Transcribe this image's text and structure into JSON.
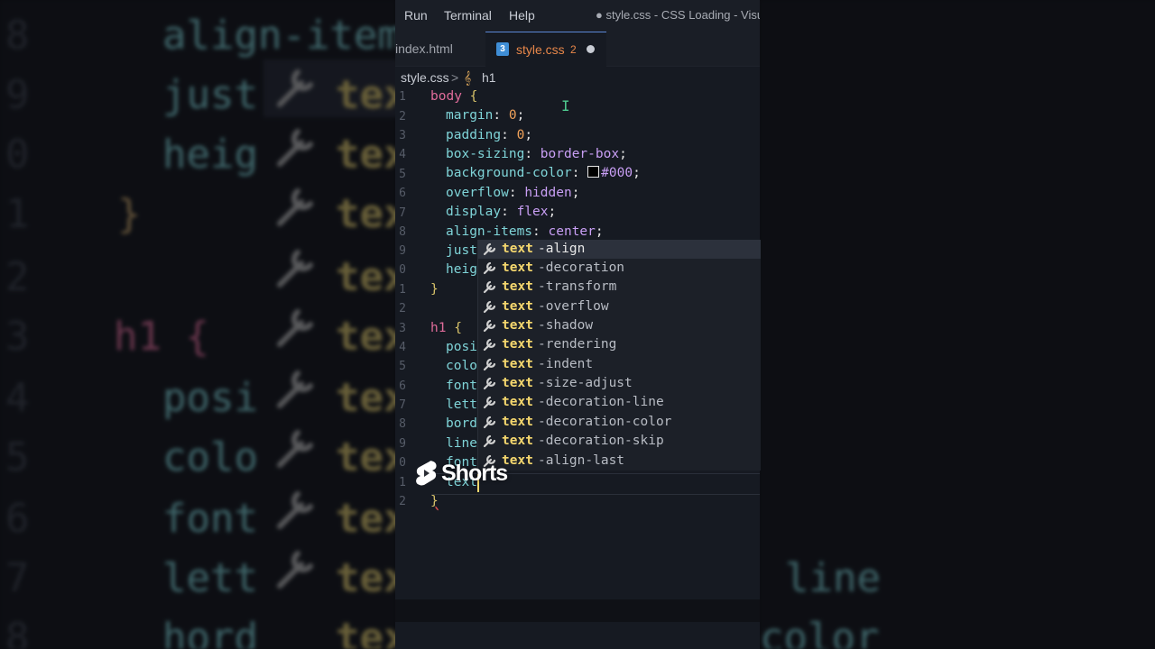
{
  "menu": [
    "Run",
    "Terminal",
    "Help"
  ],
  "window_title": "● style.css - CSS Loading - Visu",
  "tabs": {
    "inactive": "index.html",
    "active": "style.css",
    "active_problems": "2",
    "css_badge": "3"
  },
  "breadcrumb": {
    "file": "style.css",
    "sep": ">",
    "symbol": "h1"
  },
  "line_numbers": [
    "1",
    "2",
    "3",
    "4",
    "5",
    "6",
    "7",
    "8",
    "9",
    "0",
    "1",
    "2",
    "3",
    "4",
    "5",
    "6",
    "7",
    "8",
    "9",
    "0",
    "1",
    "2"
  ],
  "code": {
    "l1_sel": "body",
    "l1_brace": "{",
    "l2_prop": "margin",
    "l2_val": "0",
    "l3_prop": "padding",
    "l3_val": "0",
    "l4_prop": "box-sizing",
    "l4_val": "border-box",
    "l5_prop": "background-color",
    "l5_val": "#000",
    "l6_prop": "overflow",
    "l6_val": "hidden",
    "l7_prop": "display",
    "l7_val": "flex",
    "l8_prop": "align-items",
    "l8_val": "center",
    "l9_partial": "just",
    "l10_partial": "heig",
    "l11_brace": "}",
    "l13_sel": "h1",
    "l13_brace": "{",
    "l14_partial": "posi",
    "l15_partial": "colo",
    "l16_partial": "font",
    "l17_partial": "lett",
    "l18_partial": "bord",
    "l19_partial": "line",
    "l20_partial": "font",
    "l21_typing": "text",
    "l22_brace": "}",
    "colon": ":",
    "semi": ";"
  },
  "suggestions": {
    "match": "text",
    "items": [
      "-align",
      "-decoration",
      "-transform",
      "-overflow",
      "-shadow",
      "-rendering",
      "-indent",
      "-size-adjust",
      "-decoration-line",
      "-decoration-color",
      "-decoration-skip",
      "-align-last"
    ],
    "selected_index": 0
  },
  "background": {
    "nums": [
      "8",
      "9",
      "0",
      "1",
      "2",
      "3",
      "4",
      "5",
      "6",
      "7",
      "8"
    ],
    "lines": [
      "align-item",
      "just",
      "heig",
      "}",
      "",
      "h1 {",
      "posi",
      "colo",
      "font",
      "lett",
      "hord"
    ],
    "sug": "tex",
    "right_fragments": [
      "line",
      "color"
    ]
  },
  "overlay": {
    "shorts_label": "Shorts"
  },
  "colors": {
    "accent_tab": "#5b87d6",
    "suggest_match": "#f5d76e",
    "property": "#7fd4d8",
    "selector": "#e06c9a"
  }
}
